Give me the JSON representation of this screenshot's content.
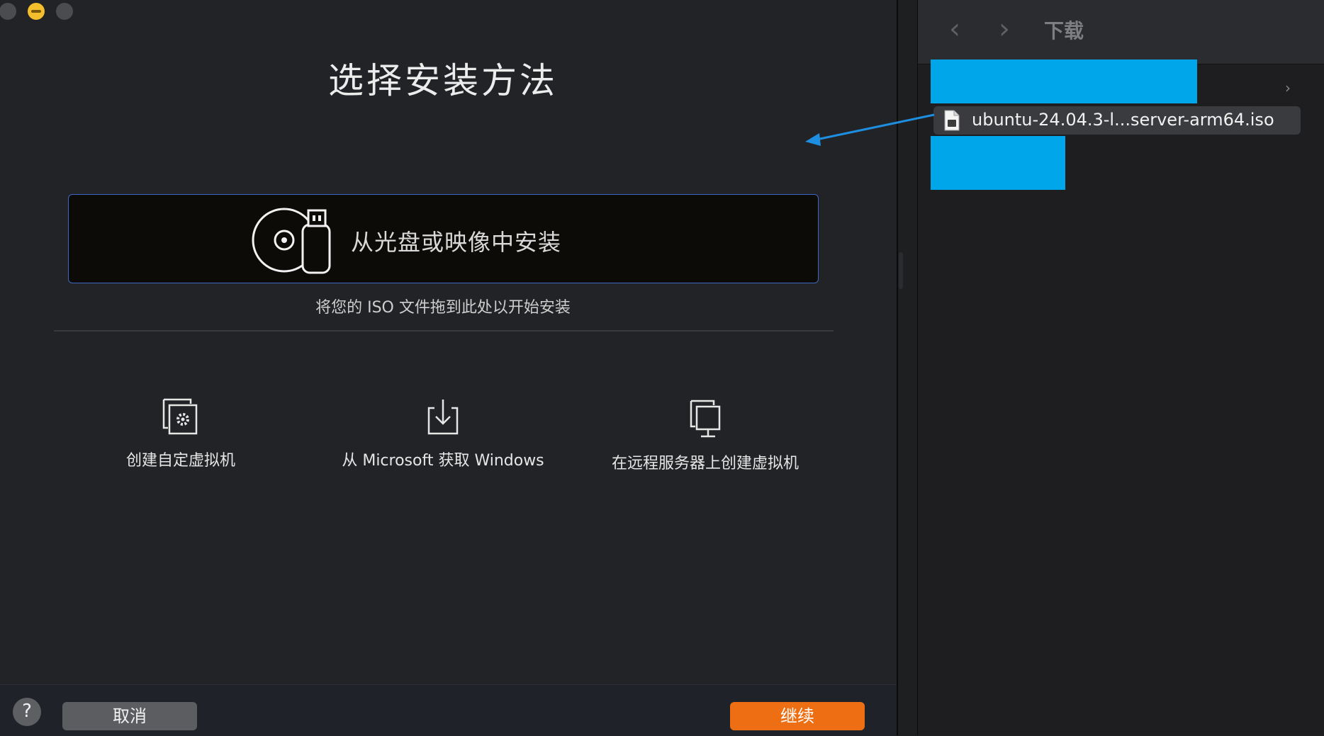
{
  "dialog": {
    "title": "选择安装方法",
    "drop_zone_label": "从光盘或映像中安装",
    "drop_hint": "将您的 ISO 文件拖到此处以开始安装",
    "options": [
      {
        "label": "创建自定虚拟机",
        "icon": "custom-vm-icon"
      },
      {
        "label": "从 Microsoft 获取 Windows",
        "icon": "download-icon"
      },
      {
        "label": "在远程服务器上创建虚拟机",
        "icon": "remote-server-icon"
      }
    ],
    "footer": {
      "help": "?",
      "cancel": "取消",
      "continue": "继续"
    }
  },
  "finder": {
    "title": "下载",
    "back_icon": "‹",
    "forward_icon": "›",
    "file_name": "ubuntu-24.04.3-l...server-arm64.iso",
    "disclosure": "›"
  },
  "colors": {
    "accent_blue": "#3f68c4",
    "continue_orange": "#ee6f13",
    "redaction_blue": "#00a6ea",
    "arrow_blue": "#1e8fe0"
  }
}
